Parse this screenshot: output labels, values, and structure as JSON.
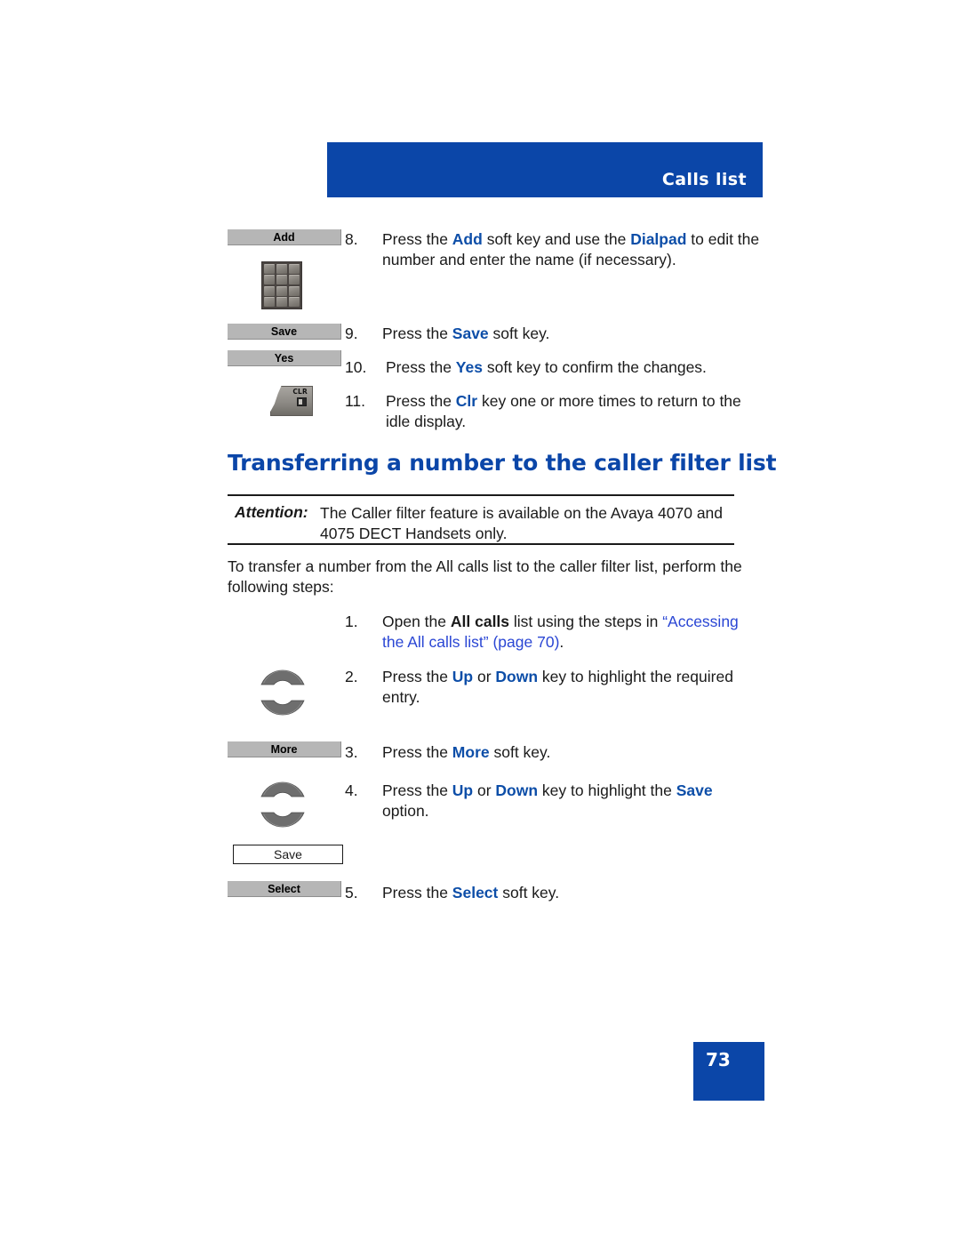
{
  "header": {
    "title": "Calls list",
    "banner_color": "#0b46a8"
  },
  "colors": {
    "accent_blue": "#0b46a8",
    "key_blue": "#0d4ea8",
    "xref_blue": "#2a46d4",
    "softkey_gray": "#b6b6b6"
  },
  "steps_top": [
    {
      "number": "8.",
      "softkey_label": "Add",
      "icon": "dialpad-icon",
      "text_parts": [
        {
          "t": "Press the ",
          "style": "plain"
        },
        {
          "t": "Add",
          "style": "key"
        },
        {
          "t": " soft key and use the ",
          "style": "plain"
        },
        {
          "t": "Dialpad",
          "style": "key"
        },
        {
          "t": " to edit the number and enter the name (if necessary).",
          "style": "plain"
        }
      ]
    },
    {
      "number": "9.",
      "softkey_label": "Save",
      "text_parts": [
        {
          "t": "Press the ",
          "style": "plain"
        },
        {
          "t": "Save",
          "style": "key"
        },
        {
          "t": " soft key.",
          "style": "plain"
        }
      ]
    },
    {
      "number": "10.",
      "softkey_label": "Yes",
      "text_parts": [
        {
          "t": "Press the ",
          "style": "plain"
        },
        {
          "t": "Yes",
          "style": "key"
        },
        {
          "t": " soft key to confirm the changes.",
          "style": "plain"
        }
      ]
    },
    {
      "number": "11.",
      "icon": "clr-key-icon",
      "icon_label": "CLR",
      "text_parts": [
        {
          "t": "Press the ",
          "style": "plain"
        },
        {
          "t": "Clr",
          "style": "key"
        },
        {
          "t": " key one or more times to return to the idle display.",
          "style": "plain"
        }
      ]
    }
  ],
  "section": {
    "heading": "Transferring a number to the caller filter list",
    "attention_label": "Attention:",
    "attention_text": "The Caller filter feature is available on the Avaya 4070 and 4075 DECT Handsets only.",
    "intro": "To transfer a number from the All calls list to the caller filter list, perform the following steps:"
  },
  "steps_bottom": [
    {
      "number": "1.",
      "text_parts": [
        {
          "t": "Open the ",
          "style": "plain"
        },
        {
          "t": "All calls",
          "style": "kblack"
        },
        {
          "t": " list using the steps in ",
          "style": "plain"
        },
        {
          "t": "“Accessing the All calls list” (page 70)",
          "style": "xref"
        },
        {
          "t": ".",
          "style": "plain"
        }
      ]
    },
    {
      "number": "2.",
      "icon": "up-down-navigation-keys-icon",
      "text_parts": [
        {
          "t": "Press the ",
          "style": "plain"
        },
        {
          "t": "Up",
          "style": "key"
        },
        {
          "t": " or ",
          "style": "plain"
        },
        {
          "t": "Down",
          "style": "key"
        },
        {
          "t": " key to highlight the required entry.",
          "style": "plain"
        }
      ]
    },
    {
      "number": "3.",
      "softkey_label": "More",
      "text_parts": [
        {
          "t": "Press the ",
          "style": "plain"
        },
        {
          "t": "More",
          "style": "key"
        },
        {
          "t": " soft key.",
          "style": "plain"
        }
      ]
    },
    {
      "number": "4.",
      "icon": "up-down-navigation-keys-icon",
      "option_box_label": "Save",
      "text_parts": [
        {
          "t": "Press the ",
          "style": "plain"
        },
        {
          "t": "Up",
          "style": "key"
        },
        {
          "t": " or ",
          "style": "plain"
        },
        {
          "t": "Down",
          "style": "key"
        },
        {
          "t": " key to highlight the ",
          "style": "plain"
        },
        {
          "t": "Save",
          "style": "key"
        },
        {
          "t": " option.",
          "style": "plain"
        }
      ]
    },
    {
      "number": "5.",
      "softkey_label": "Select",
      "text_parts": [
        {
          "t": "Press the ",
          "style": "plain"
        },
        {
          "t": "Select",
          "style": "key"
        },
        {
          "t": " soft key.",
          "style": "plain"
        }
      ]
    }
  ],
  "footer": {
    "page_number": "73"
  }
}
